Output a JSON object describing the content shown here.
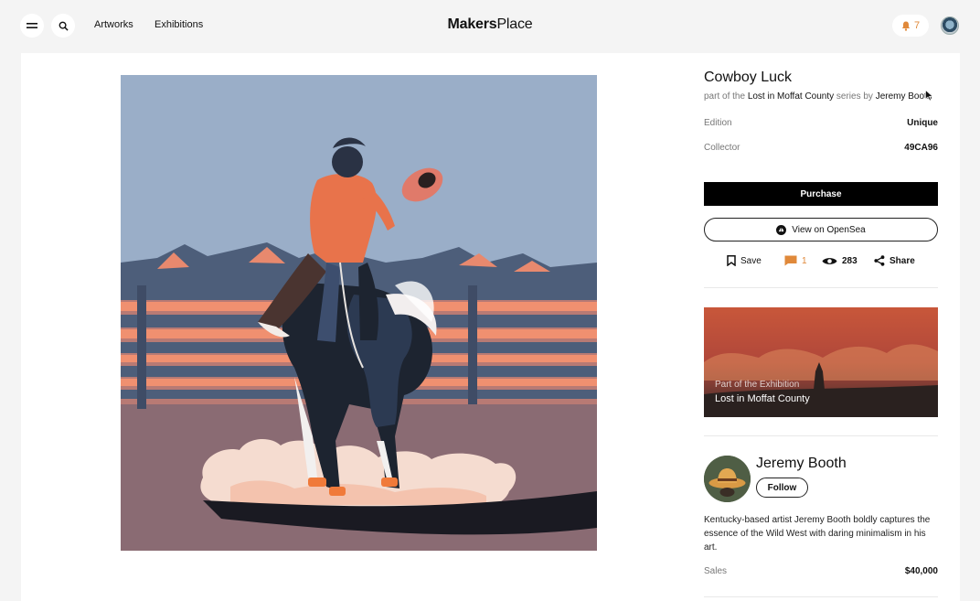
{
  "nav": {
    "links": [
      "Artworks",
      "Exhibitions"
    ],
    "logo_bold": "Makers",
    "logo_light": "Place",
    "notification_count": "7"
  },
  "artwork": {
    "title": "Cowboy Luck",
    "series_prefix": "part of the",
    "series_name": "Lost in Moffat County",
    "series_mid": "series by",
    "artist": "Jeremy Booth",
    "edition_label": "Edition",
    "edition_value": "Unique",
    "collector_label": "Collector",
    "collector_value": "49CA96",
    "purchase_label": "Purchase",
    "opensea_label": "View on OpenSea"
  },
  "actions": {
    "save_label": "Save",
    "comments_count": "1",
    "views_count": "283",
    "share_label": "Share"
  },
  "exhibition": {
    "subtitle": "Part of the Exhibition",
    "title": "Lost in Moffat County"
  },
  "artist": {
    "name": "Jeremy Booth",
    "follow_label": "Follow",
    "bio": "Kentucky-based artist Jeremy Booth boldly captures the essence of the Wild West with daring minimalism in his art.",
    "sales_label": "Sales",
    "sales_value": "$40,000"
  },
  "colors": {
    "accent_orange": "#e0893a",
    "button_black": "#000000"
  },
  "icons": [
    "menu-icon",
    "search-icon",
    "bell-icon",
    "bookmark-icon",
    "comment-icon",
    "eye-icon",
    "share-icon",
    "opensea-icon",
    "cursor-icon"
  ]
}
